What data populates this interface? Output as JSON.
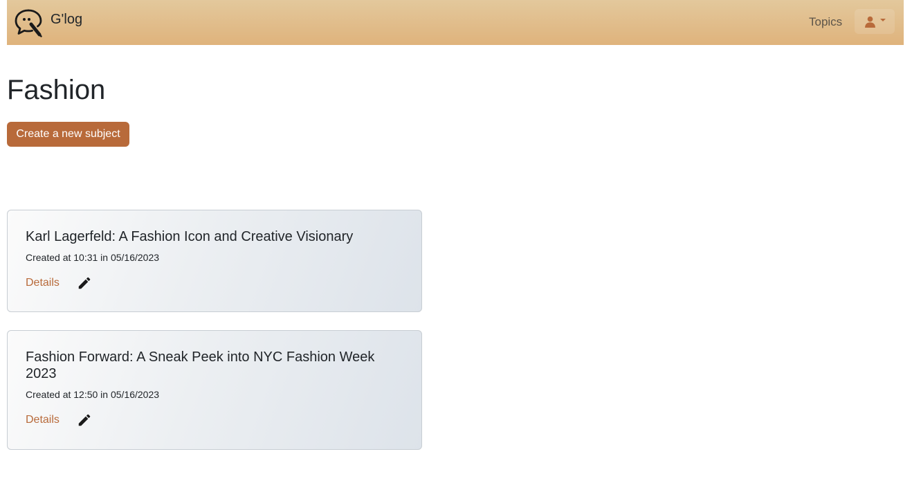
{
  "navbar": {
    "brand_name": "G'log",
    "logo_icon": "chat-bubble-pen-icon",
    "topics_label": "Topics",
    "user_icon": "user-icon",
    "accent": "#b86a3a"
  },
  "page": {
    "title": "Fashion",
    "create_button_label": "Create a new subject"
  },
  "subjects": [
    {
      "title": "Karl Lagerfeld: A Fashion Icon and Creative Visionary",
      "created": "Created at 10:31 in 05/16/2023",
      "details_label": "Details",
      "edit_icon": "pencil-icon"
    },
    {
      "title": "Fashion Forward: A Sneak Peek into NYC Fashion Week 2023",
      "created": "Created at 12:50 in 05/16/2023",
      "details_label": "Details",
      "edit_icon": "pencil-icon"
    }
  ]
}
